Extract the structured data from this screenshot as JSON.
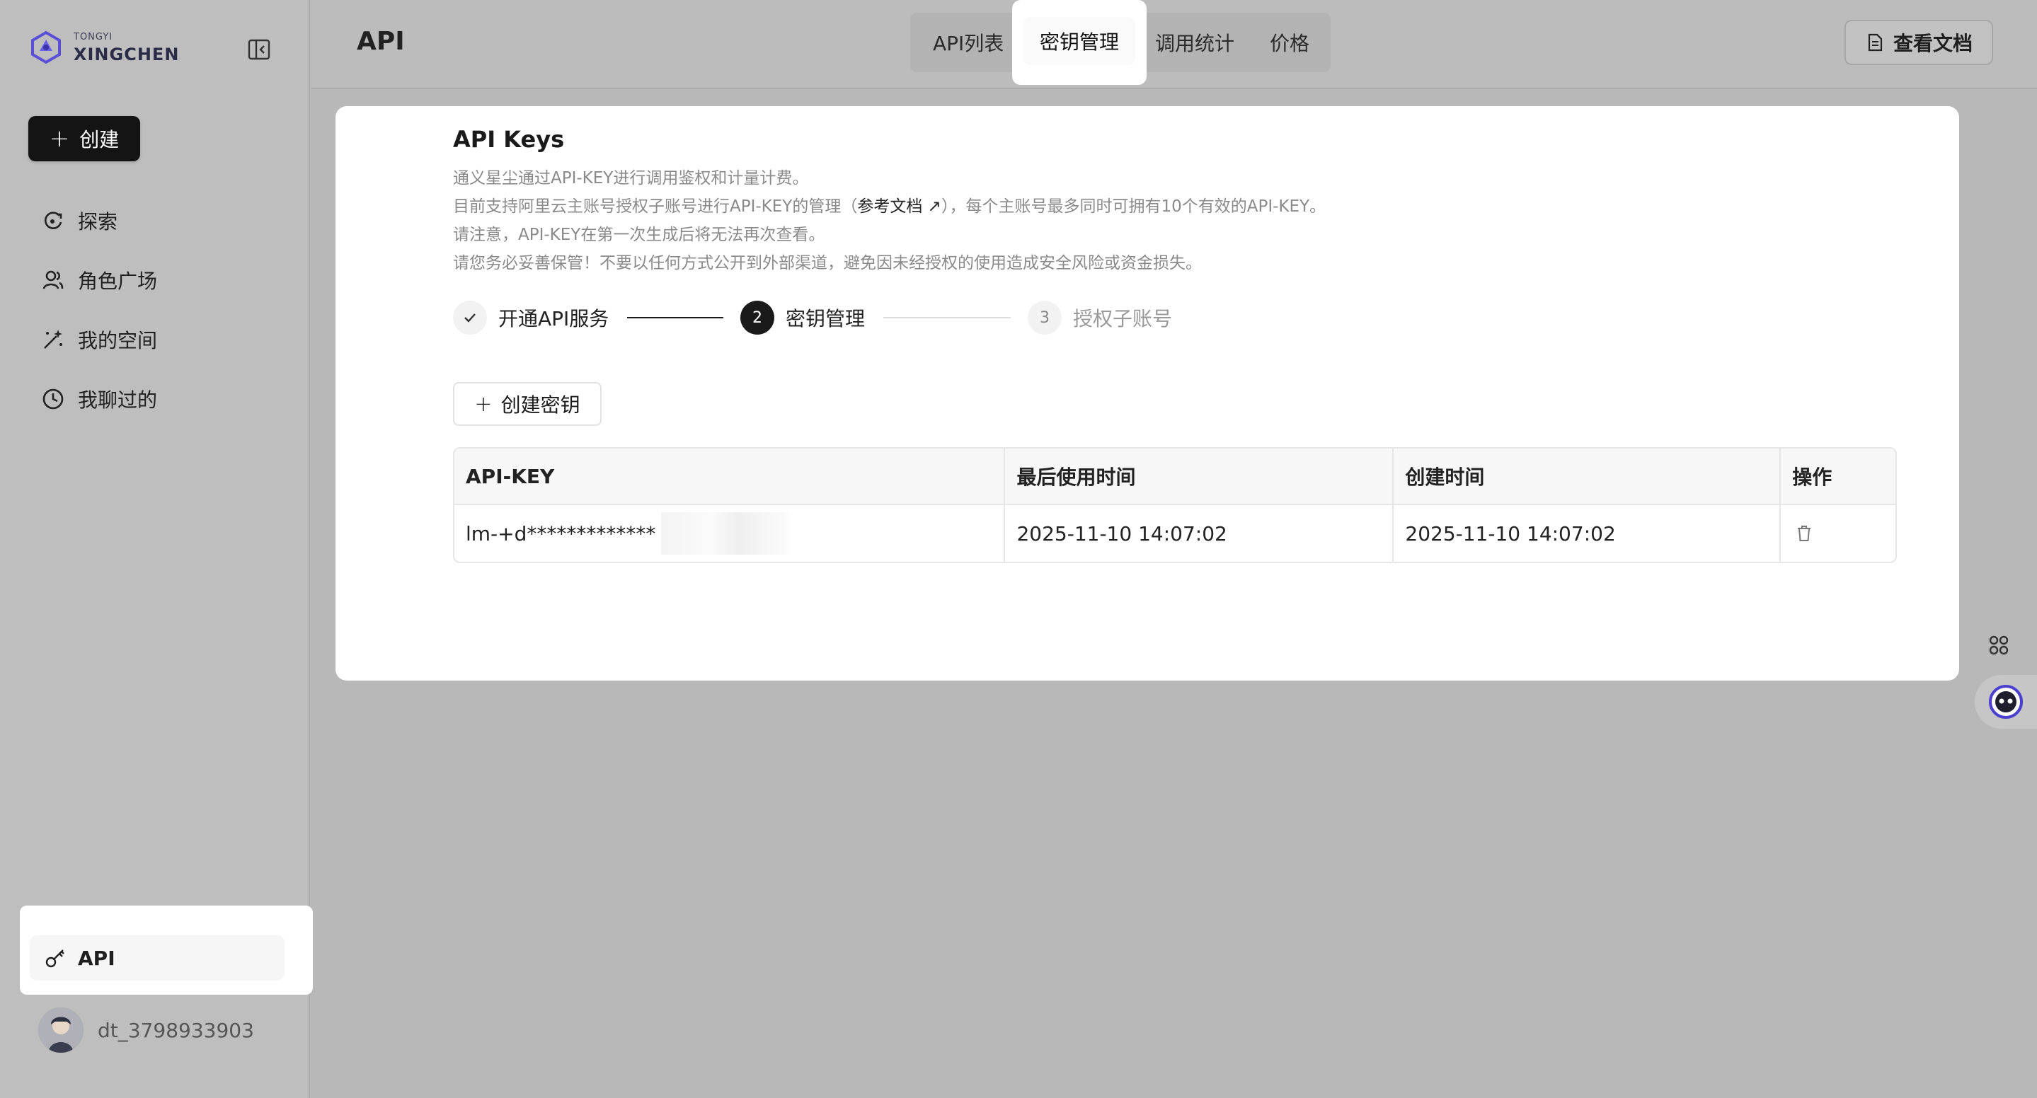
{
  "brand": {
    "small": "TONGYI",
    "name": "XINGCHEN"
  },
  "sidebar": {
    "create_label": "创建",
    "items": [
      {
        "label": "探索",
        "icon": "explore-icon"
      },
      {
        "label": "角色广场",
        "icon": "people-icon"
      },
      {
        "label": "我的空间",
        "icon": "magic-wand-icon"
      },
      {
        "label": "我聊过的",
        "icon": "clock-icon"
      }
    ],
    "api_label": "API",
    "username": "dt_3798933903"
  },
  "header": {
    "title": "API",
    "tabs": [
      "API列表",
      "密钥管理",
      "调用统计",
      "价格"
    ],
    "active_tab": "密钥管理",
    "doc_button": "查看文档"
  },
  "card": {
    "title": "API Keys",
    "desc_line1": "通义星尘通过API-KEY进行调用鉴权和计量计费。",
    "desc_line2_a": "目前支持阿里云主账号授权子账号进行API-KEY的管理（",
    "desc_line2_link": "参考文档",
    "desc_line2_b": "），每个主账号最多同时可拥有10个有效的API-KEY。",
    "desc_line3": "请注意，API-KEY在第一次生成后将无法再次查看。",
    "desc_line4": "请您务必妥善保管！不要以任何方式公开到外部渠道，避免因未经授权的使用造成安全风险或资金损失。",
    "steps": [
      {
        "label": "开通API服务",
        "state": "done"
      },
      {
        "number": "2",
        "label": "密钥管理",
        "state": "active"
      },
      {
        "number": "3",
        "label": "授权子账号",
        "state": "todo"
      }
    ],
    "create_key_label": "创建密钥",
    "table": {
      "headers": [
        "API-KEY",
        "最后使用时间",
        "创建时间",
        "操作"
      ],
      "rows": [
        {
          "key": "lm-+d*************",
          "last_used": "2025-11-10 14:07:02",
          "created": "2025-11-10 14:07:02"
        }
      ]
    }
  }
}
